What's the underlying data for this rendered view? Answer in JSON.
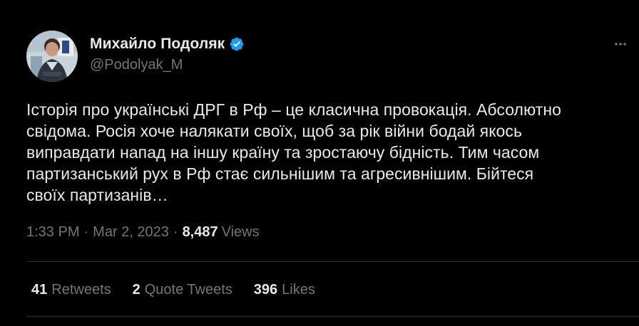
{
  "author": {
    "display_name": "Михайло Подоляк",
    "handle": "@Podolyak_M",
    "verified": true,
    "verified_icon": "verified-badge-icon"
  },
  "tweet": {
    "text": "Історія про українські ДРГ в Рф – це класична провокація. Абсолютно\nсвідома. Росія хоче налякати своїх, щоб за рік війни бодай якось\nвиправдати напад на іншу країну та зростаючу бідність. Тим часом\nпартизанський рух в Рф стає сильнішим та агресивнішим. Бійтеся\nсвоїх партизанів…"
  },
  "meta": {
    "time": "1:33 PM",
    "separator": "·",
    "date": "Mar 2, 2023",
    "views_count": "8,487",
    "views_label": "Views"
  },
  "stats": {
    "retweets_count": "41",
    "retweets_label": "Retweets",
    "quotes_count": "2",
    "quotes_label": "Quote Tweets",
    "likes_count": "396",
    "likes_label": "Likes"
  },
  "colors": {
    "background": "#000000",
    "primary_text": "#e7e9ea",
    "secondary_text": "#71767b",
    "verified": "#1d9bf0",
    "divider": "#2f3336"
  }
}
